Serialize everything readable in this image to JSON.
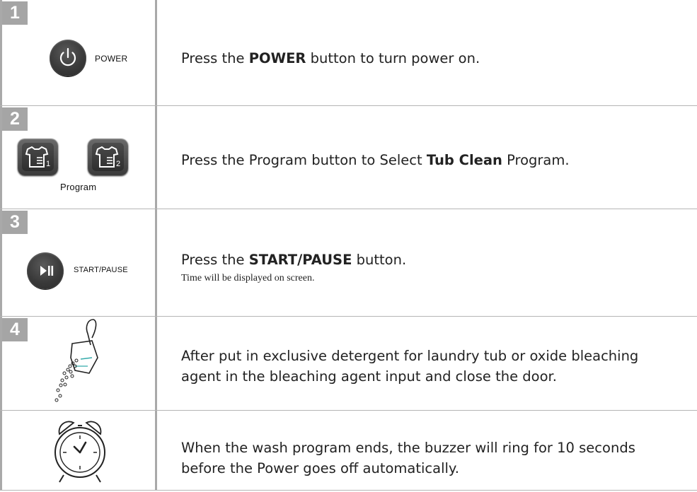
{
  "steps": [
    {
      "badge": "1",
      "text_pre": "Press the ",
      "text_bold": "POWER",
      "text_post": " button to turn power on.",
      "button_label": "POWER"
    },
    {
      "badge": "2",
      "text_pre": "Press the Program button to Select ",
      "text_bold": "Tub Clean",
      "text_post": " Program.",
      "button_label": "Program",
      "btn1_digit": "1",
      "btn2_digit": "2"
    },
    {
      "badge": "3",
      "text_pre": "Press the ",
      "text_bold": "START/PAUSE",
      "text_post": " button.",
      "sub_text": "Time will be displayed on screen.",
      "button_label": "START/PAUSE"
    },
    {
      "badge": "4",
      "line1": "After put in exclusive detergent for laundry tub or oxide bleaching",
      "line2": "agent in the bleaching agent input and close the door."
    },
    {
      "line1": "When the wash program ends, the buzzer will ring for 10 seconds",
      "line2": "before the Power goes off automatically."
    }
  ]
}
